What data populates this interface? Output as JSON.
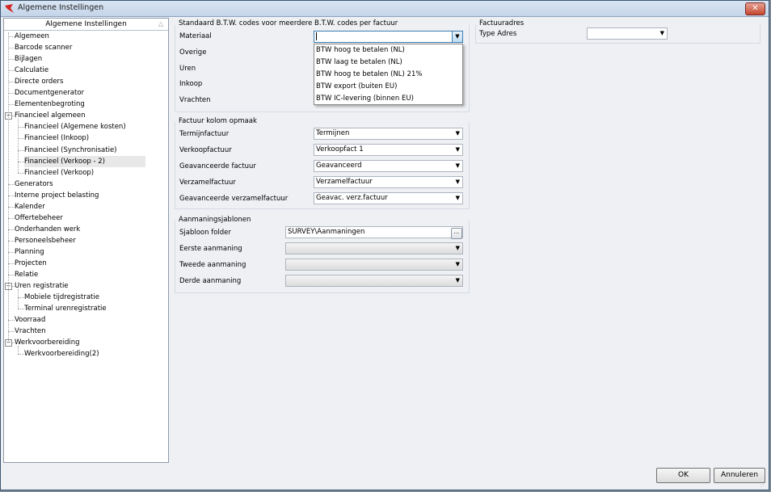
{
  "window": {
    "title": "Algemene Instellingen",
    "close_label": "✕"
  },
  "tree": {
    "header": "Algemene Instellingen",
    "items": [
      {
        "label": "Algemeen"
      },
      {
        "label": "Barcode scanner"
      },
      {
        "label": "Bijlagen"
      },
      {
        "label": "Calculatie"
      },
      {
        "label": "Directe orders"
      },
      {
        "label": "Documentgenerator"
      },
      {
        "label": "Elementenbegroting"
      },
      {
        "label": "Financieel algemeen"
      },
      {
        "label": "Financieel (Algemene kosten)"
      },
      {
        "label": "Financieel (Inkoop)"
      },
      {
        "label": "Financieel (Synchronisatie)"
      },
      {
        "label": "Financieel (Verkoop - 2)"
      },
      {
        "label": "Financieel (Verkoop)"
      },
      {
        "label": "Generators"
      },
      {
        "label": "Interne project belasting"
      },
      {
        "label": "Kalender"
      },
      {
        "label": "Offertebeheer"
      },
      {
        "label": "Onderhanden werk"
      },
      {
        "label": "Personeelsbeheer"
      },
      {
        "label": "Planning"
      },
      {
        "label": "Projecten"
      },
      {
        "label": "Relatie"
      },
      {
        "label": "Uren registratie"
      },
      {
        "label": "Mobiele tijdregistratie"
      },
      {
        "label": "Terminal urenregistratie"
      },
      {
        "label": "Voorraad"
      },
      {
        "label": "Vrachten"
      },
      {
        "label": "Werkvoorbereiding"
      },
      {
        "label": "Werkvoorbereiding(2)"
      }
    ]
  },
  "btw": {
    "title": "Standaard B.T.W. codes voor meerdere B.T.W. codes per factuur",
    "labels": {
      "materiaal": "Materiaal",
      "overige": "Overige",
      "uren": "Uren",
      "inkoop": "Inkoop",
      "vrachten": "Vrachten"
    },
    "materiaal_value": "",
    "dropdown_options": [
      "BTW hoog te betalen (NL)",
      "BTW laag te betalen (NL)",
      "BTW hoog te betalen (NL) 21%",
      "BTW export (buiten EU)",
      "BTW IC-levering (binnen EU)"
    ]
  },
  "kolom": {
    "title": "Factuur kolom opmaak",
    "rows": [
      {
        "label": "Termijnfactuur",
        "value": "Termijnen"
      },
      {
        "label": "Verkoopfactuur",
        "value": "Verkoopfact 1"
      },
      {
        "label": "Geavanceerde factuur",
        "value": "Geavanceerd"
      },
      {
        "label": "Verzamelfactuur",
        "value": "Verzamelfactuur"
      },
      {
        "label": "Geavanceerde verzamelfactuur",
        "value": "Geavac. verz.factuur"
      }
    ]
  },
  "aanmaning": {
    "title": "Aanmaningsjablonen",
    "folder_label": "Sjabloon folder",
    "folder_value": "SURVEY\\Aanmaningen",
    "browse_label": "...",
    "labels": {
      "eerste": "Eerste aanmaning",
      "tweede": "Tweede aanmaning",
      "derde": "Derde aanmaning"
    }
  },
  "factuuradres": {
    "title": "Factuuradres",
    "type_label": "Type Adres",
    "type_value": ""
  },
  "buttons": {
    "ok": "OK",
    "cancel": "Annuleren"
  },
  "glyphs": {
    "arrow": "▼",
    "sort": "△",
    "minus": "−"
  },
  "colors": {
    "titlebar": "#c4d4e8",
    "close": "#c7472f",
    "focus": "#3c7fb1"
  }
}
